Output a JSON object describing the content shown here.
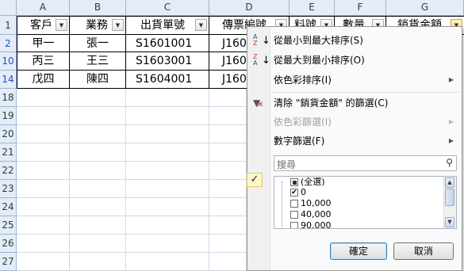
{
  "columns": [
    "A",
    "B",
    "C",
    "D",
    "E",
    "F",
    "G"
  ],
  "rows": [
    "1",
    "2",
    "10",
    "14",
    "18",
    "19",
    "20",
    "21",
    "22",
    "23",
    "24",
    "25",
    "26",
    "27"
  ],
  "headers": [
    "客戶",
    "業務",
    "出貨單號",
    "傳票編號",
    "料號",
    "數量",
    "銷貨金額"
  ],
  "data": [
    [
      "甲一",
      "張一",
      "S1601001",
      "J160"
    ],
    [
      "丙三",
      "王三",
      "S1603001",
      "J160"
    ],
    [
      "戊四",
      "陳四",
      "S1604001",
      "J160"
    ]
  ],
  "menu": {
    "sort_asc": "從最小到最大排序(S)",
    "sort_desc": "從最大到最小排序(O)",
    "sort_color": "依色彩排序(I)",
    "clear_filter": "清除 \"銷貨金額\" 的篩選(C)",
    "filter_color": "依色彩篩選(I)",
    "number_filter": "數字篩選(F)",
    "search_placeholder": "搜尋",
    "list": [
      "(全選)",
      "0",
      "10,000",
      "40,000",
      "90,000"
    ],
    "ok": "確定",
    "cancel": "取消"
  },
  "icons": {
    "sort_asc": "sort-ascending-icon",
    "sort_desc": "sort-descending-icon",
    "clear_filter": "clear-filter-icon",
    "search": "search-icon"
  },
  "colors": {
    "header_bg": "#e4ecf7",
    "filtered_row": "#1f4fcc",
    "active_filter": "#f9d776"
  }
}
